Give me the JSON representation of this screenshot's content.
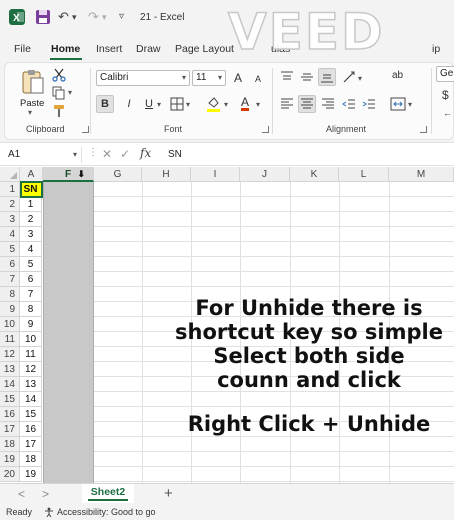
{
  "title_bar": {
    "title": "21 - Excel",
    "watermark": "VEED",
    "undo_glyph": "↶",
    "redo_glyph": "↷",
    "dropdown_glyph": "▾",
    "customize_glyph": "▿"
  },
  "menu": {
    "tabs": [
      "File",
      "Home",
      "Insert",
      "Draw",
      "Page Layout",
      "ulas",
      "ip"
    ],
    "active": "Home"
  },
  "ribbon": {
    "clipboard": {
      "paste_label": "Paste",
      "group_label": "Clipboard"
    },
    "font": {
      "font_name": "Calibri",
      "font_size": "11",
      "grow_label": "A",
      "shrink_label": "A",
      "bold_label": "B",
      "italic_label": "I",
      "underline_label": "U",
      "font_color_label": "A",
      "group_label": "Font"
    },
    "alignment": {
      "group_label": "Alignment",
      "wrap_label": "ab"
    },
    "number": {
      "format_label": "Gen",
      "currency_label": "$"
    },
    "accent_color": "#1d6f42"
  },
  "formula_bar": {
    "name_box": "A1",
    "cancel_glyph": "✕",
    "enter_glyph": "✓",
    "fx_label": "fx",
    "content": "SN"
  },
  "grid": {
    "column_headers": [
      "A",
      "F",
      "G",
      "H",
      "I",
      "J",
      "K",
      "L",
      "M"
    ],
    "selected_column": "F",
    "hidden_marker_glyph": "⬇",
    "row_numbers": [
      "1",
      "2",
      "3",
      "4",
      "5",
      "6",
      "7",
      "8",
      "9",
      "10",
      "11",
      "12",
      "13",
      "14",
      "15",
      "16",
      "17",
      "18",
      "19",
      "20"
    ],
    "column_a_values": [
      "SN",
      "1",
      "2",
      "3",
      "4",
      "5",
      "6",
      "7",
      "8",
      "9",
      "10",
      "11",
      "12",
      "13",
      "14",
      "15",
      "16",
      "17",
      "18",
      "19"
    ],
    "header_fill": "#ffff00"
  },
  "overlay": {
    "line1": "For Unhide there is",
    "line2": "shortcut key so simple",
    "line3": "Select both side",
    "line4": "counn and click",
    "line5": "Right Click + Unhide"
  },
  "sheet_tabs": {
    "prev_glyph": "<",
    "next_glyph": ">",
    "active_sheet": "Sheet2",
    "add_glyph": "+"
  },
  "status_bar": {
    "ready": "Ready",
    "accessibility": "Accessibility: Good to go"
  }
}
